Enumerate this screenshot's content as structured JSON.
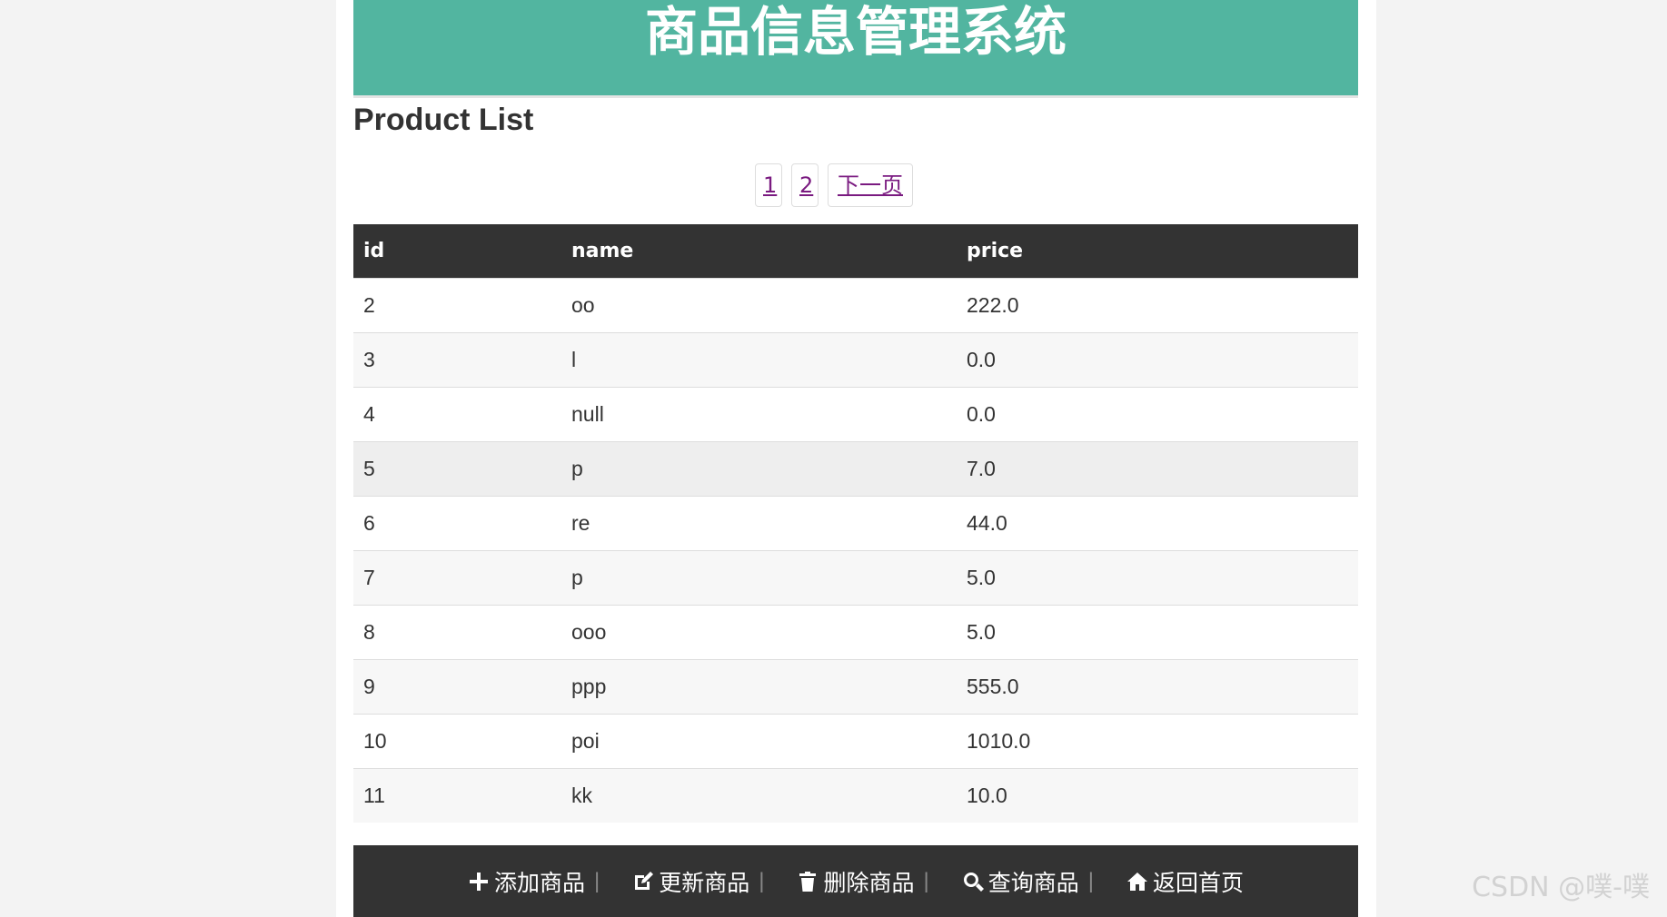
{
  "header": {
    "title": "商品信息管理系统"
  },
  "section_title": "Product List",
  "pager": {
    "pages": [
      "1",
      "2"
    ],
    "next_label": "下一页"
  },
  "table": {
    "columns": [
      "id",
      "name",
      "price"
    ],
    "rows": [
      {
        "id": "2",
        "name": "oo",
        "price": "222.0"
      },
      {
        "id": "3",
        "name": "l",
        "price": "0.0"
      },
      {
        "id": "4",
        "name": "null",
        "price": "0.0"
      },
      {
        "id": "5",
        "name": "p",
        "price": "7.0"
      },
      {
        "id": "6",
        "name": "re",
        "price": "44.0"
      },
      {
        "id": "7",
        "name": "p",
        "price": "5.0"
      },
      {
        "id": "8",
        "name": "ooo",
        "price": "5.0"
      },
      {
        "id": "9",
        "name": "ppp",
        "price": "555.0"
      },
      {
        "id": "10",
        "name": "poi",
        "price": "1010.0"
      },
      {
        "id": "11",
        "name": "kk",
        "price": "10.0"
      }
    ]
  },
  "nav": {
    "items": [
      {
        "icon": "plus-icon",
        "label": "添加商品"
      },
      {
        "icon": "edit-icon",
        "label": "更新商品"
      },
      {
        "icon": "trash-icon",
        "label": "删除商品"
      },
      {
        "icon": "search-icon",
        "label": "查询商品"
      },
      {
        "icon": "home-icon",
        "label": "返回首页"
      }
    ],
    "separator": "|"
  },
  "watermark": "CSDN @噗-噗",
  "colors": {
    "header_bg": "#52b5a0",
    "table_header_bg": "#333333",
    "link": "#7a1a80"
  }
}
